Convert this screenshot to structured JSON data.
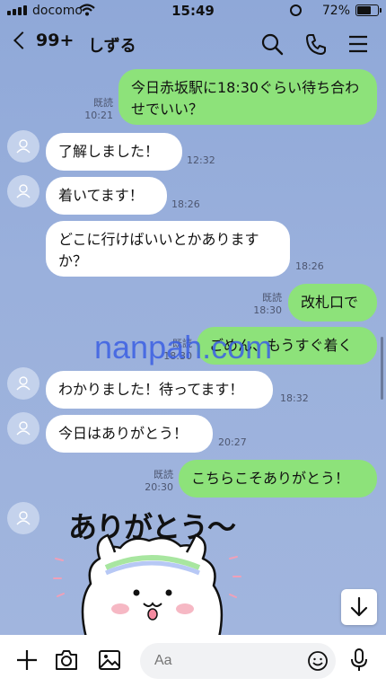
{
  "status": {
    "carrier": "docomo",
    "time": "15:49",
    "battery": "72%",
    "battery_level": 0.72
  },
  "header": {
    "back_label": "99+",
    "title": "しずる"
  },
  "messages": [
    {
      "dir": "out",
      "text": "今日赤坂駅に18:30ぐらい待ち合わせでいい？",
      "read": "既読",
      "time": "10:21"
    },
    {
      "dir": "in",
      "text": "了解しました！",
      "time": "12:32"
    },
    {
      "dir": "in",
      "text": "着いてます！",
      "time": "18:26"
    },
    {
      "dir": "in",
      "text": "どこに行けばいいとかありますか？",
      "time": "18:26"
    },
    {
      "dir": "out",
      "text": "改札口で",
      "read": "既読",
      "time": "18:30"
    },
    {
      "dir": "out",
      "text": "ごめん、もうすぐ着く",
      "read": "既読",
      "time": "18:30"
    },
    {
      "dir": "in",
      "text": "わかりました！待ってます！",
      "time": "18:32"
    },
    {
      "dir": "in",
      "text": "今日はありがとう！",
      "time": "20:27"
    },
    {
      "dir": "out",
      "text": "こちらこそありがとう！",
      "read": "既読",
      "time": "20:30"
    }
  ],
  "sticker": {
    "text": "ありがとう〜"
  },
  "watermark": "nanpah.com",
  "input": {
    "placeholder": "Aa"
  },
  "icons": {
    "header": [
      "search-icon",
      "phone-icon",
      "menu-icon"
    ],
    "input_bar": [
      "plus-icon",
      "camera-icon",
      "image-icon",
      "emoji-icon",
      "microphone-icon"
    ],
    "scroll": "arrow-down-icon"
  },
  "colors": {
    "background": "#9ab0dc",
    "outgoing_bubble": "#8de27a",
    "incoming_bubble": "#ffffff"
  }
}
